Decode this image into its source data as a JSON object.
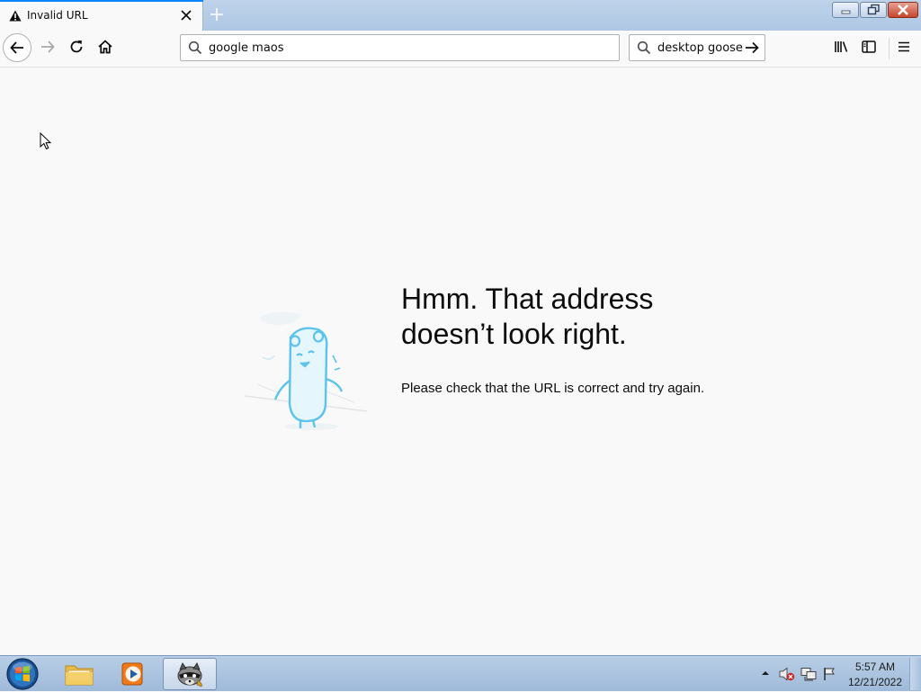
{
  "browser": {
    "tab": {
      "title": "Invalid URL",
      "icon": "warning-icon"
    },
    "urlbar": {
      "value": "google maos",
      "icon": "search-icon"
    },
    "searchbar": {
      "value": "desktop goose",
      "icon": "search-icon"
    },
    "toolbar_icons": [
      "back-arrow-icon",
      "forward-arrow-icon",
      "reload-icon",
      "home-icon",
      "library-icon",
      "sidebar-icon",
      "hamburger-menu-icon"
    ],
    "accent": "#0a84ff"
  },
  "error_page": {
    "title_line1": "Hmm. That address",
    "title_line2": "doesn’t look right.",
    "description": "Please check that the URL is correct and try again.",
    "illustration_color": "#5cc3ea"
  },
  "taskbar": {
    "items": [
      "start-orb",
      "file-explorer",
      "media-player",
      "desktop-goose"
    ],
    "tray_icons": [
      "show-hidden-icons",
      "volume-muted-icon",
      "network-icon",
      "action-center-flag-icon"
    ],
    "clock": {
      "time": "5:57 AM",
      "date": "12/21/2022"
    }
  }
}
